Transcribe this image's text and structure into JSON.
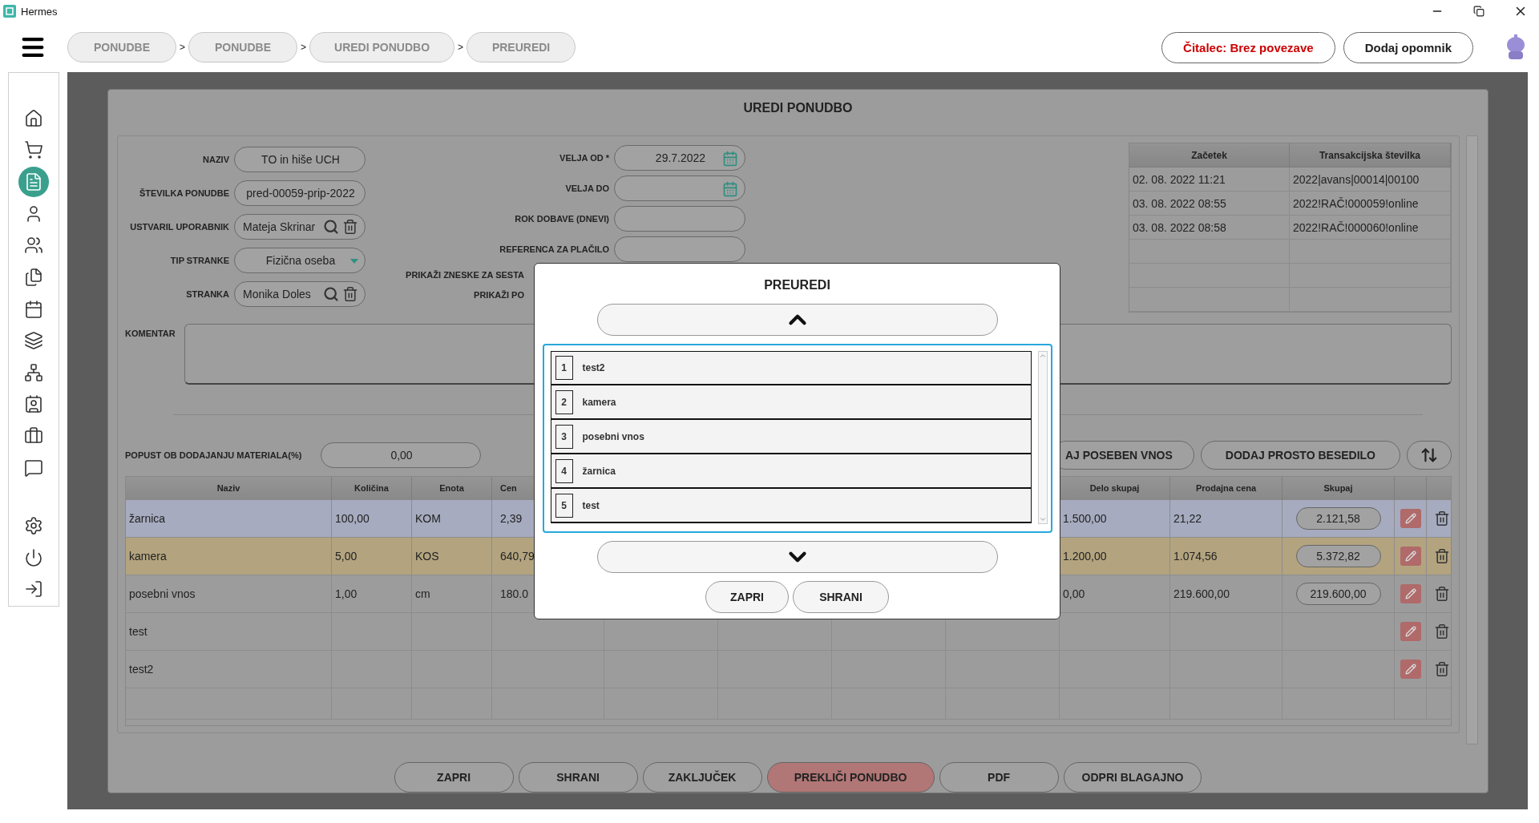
{
  "window": {
    "title": "Hermes"
  },
  "breadcrumbs": {
    "items": [
      "PONUDBE",
      "PONUDBE",
      "UREDI PONUDBO",
      "PREUREDI"
    ],
    "separators": [
      ">",
      ">",
      ">"
    ]
  },
  "header_buttons": [
    {
      "label": "Čitalec: Brez povezave",
      "kind": "status"
    },
    {
      "label": "Dodaj opomnik",
      "kind": "action"
    }
  ],
  "sidebar": {
    "items": [
      {
        "kind": "home",
        "selected": false
      },
      {
        "kind": "cart",
        "selected": false
      },
      {
        "kind": "document",
        "selected": true
      },
      {
        "kind": "person",
        "selected": false
      },
      {
        "kind": "people",
        "selected": false
      },
      {
        "kind": "documents",
        "selected": false
      },
      {
        "kind": "calendar",
        "selected": false
      },
      {
        "kind": "layers",
        "selected": false
      },
      {
        "kind": "network",
        "selected": false
      },
      {
        "kind": "contact",
        "selected": false
      },
      {
        "kind": "briefcase",
        "selected": false
      },
      {
        "kind": "chat",
        "selected": false
      }
    ],
    "bottom_items": [
      {
        "kind": "settings",
        "selected": false
      },
      {
        "kind": "power",
        "selected": false
      },
      {
        "kind": "logout",
        "selected": false
      }
    ]
  },
  "editor": {
    "title": "UREDI PONUDBO",
    "fields_left": [
      {
        "label": "NAZIV",
        "value": "TO in hiše UCH",
        "kind": "text"
      },
      {
        "label": "ŠTEVILKA PONUDBE",
        "value": "pred-00059-prip-2022",
        "kind": "text"
      },
      {
        "label": "USTVARIL UPORABNIK",
        "value": "Mateja Skrinar",
        "kind": "lookup"
      },
      {
        "label": "TIP STRANKE",
        "value": "Fizična oseba",
        "kind": "select"
      },
      {
        "label": "STRANKA",
        "value": "Monika Doles",
        "kind": "lookup"
      }
    ],
    "fields_right": [
      {
        "label": "VELJA OD *",
        "value": "29.7.2022",
        "kind": "date"
      },
      {
        "label": "VELJA DO",
        "kind": "date"
      },
      {
        "label": "ROK DOBAVE (DNEVI)",
        "kind": "text"
      },
      {
        "label": "REFERENCA ZA PLAČILO",
        "kind": "text"
      },
      {
        "label": "PRIKAŽI ZNESKE ZA SESTA",
        "kind": "covered"
      },
      {
        "label": "PRIKAŽI PO",
        "kind": "covered"
      }
    ],
    "transactions": {
      "columns": [
        "Začetek",
        "Transakcijska številka"
      ],
      "rows": [
        [
          "02. 08. 2022 11:21",
          "2022|avans|00014|00100"
        ],
        [
          "03. 08. 2022 08:55",
          "2022!RAČ!000059!online"
        ],
        [
          "03. 08. 2022 08:58",
          "2022!RAČ!000060!online"
        ]
      ]
    },
    "comment": {
      "label": "KOMENTAR"
    },
    "discount": {
      "label": "POPUST OB DODAJANJU MATERIALA(%)",
      "value": "0,00"
    },
    "actions": [
      "AJ POSEBEN VNOS",
      "DODAJ PROSTO BESEDILO"
    ],
    "table": {
      "columns": [
        "Naziv",
        "Količina",
        "Enota",
        "Cen",
        "Delo skupaj",
        "Prodajna cena",
        "Skupaj"
      ],
      "rows": [
        {
          "naziv": "žarnica",
          "kolicina": "100,00",
          "enota": "KOM",
          "cena": "2,39",
          "delo_skupaj": "1.500,00",
          "prodajna_cena": "21,22",
          "skupaj": "2.121,58",
          "color": "#a6abbf"
        },
        {
          "naziv": "kamera",
          "kolicina": "5,00",
          "enota": "KOS",
          "cena": "640,79",
          "delo_skupaj": "1.200,00",
          "prodajna_cena": "1.074,56",
          "skupaj": "5.372,82",
          "color": "#b3a47f"
        },
        {
          "naziv": "posebni vnos",
          "kolicina": "1,00",
          "enota": "cm",
          "cena": "180.0",
          "delo_skupaj": "0,00",
          "prodajna_cena": "219.600,00",
          "skupaj": "219.600,00"
        },
        {
          "naziv": "test"
        },
        {
          "naziv": "test2"
        }
      ]
    },
    "buttons": [
      {
        "label": "ZAPRI",
        "kind": "normal"
      },
      {
        "label": "SHRANI",
        "kind": "normal"
      },
      {
        "label": "ZAKLJUČEK",
        "kind": "normal"
      },
      {
        "label": "PREKLIČI PONUDBO",
        "kind": "danger"
      },
      {
        "label": "PDF",
        "kind": "normal"
      },
      {
        "label": "ODPRI BLAGAJNO",
        "kind": "normal"
      }
    ]
  },
  "modal": {
    "title": "PREUREDI",
    "items": [
      {
        "index": "1",
        "label": "test2"
      },
      {
        "index": "2",
        "label": "kamera"
      },
      {
        "index": "3",
        "label": "posebni vnos"
      },
      {
        "index": "4",
        "label": "žarnica"
      },
      {
        "index": "5",
        "label": "test"
      }
    ],
    "buttons": [
      "ZAPRI",
      "SHRANI"
    ]
  }
}
